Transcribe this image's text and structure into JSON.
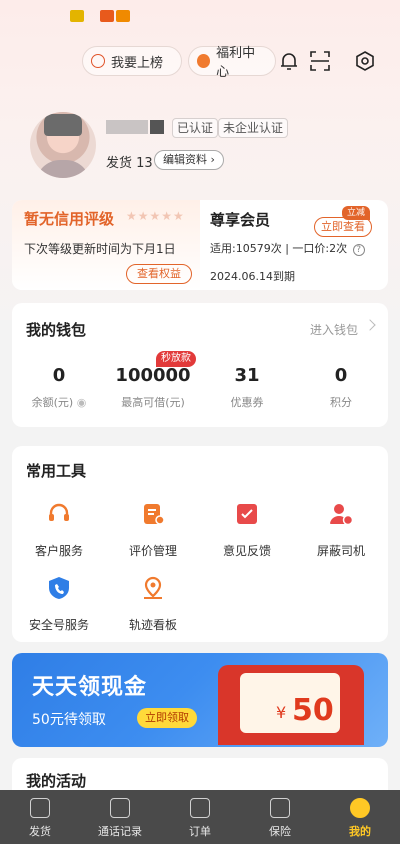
{
  "header": {
    "rank_label": "我要上榜",
    "welfare_label": "福利中心"
  },
  "profile": {
    "verified_tag": "已认证",
    "company_tag": "未企业认证",
    "shipments": "发货 13",
    "edit_label": "编辑资料"
  },
  "credit": {
    "title": "暂无信用评级",
    "stars": "★★★★★",
    "note": "下次等级更新时间为下月1日",
    "view_rights": "查看权益"
  },
  "member": {
    "title": "尊享会员",
    "renew_badge": "立减",
    "view_now": "立即查看",
    "usage": "适用:10579次 | 一口价:2次",
    "help": "?",
    "expire": "2024.06.14到期"
  },
  "wallet": {
    "title": "我的钱包",
    "link": "进入钱包",
    "flash_badge": "秒放款",
    "items": [
      {
        "value": "0",
        "label": "余额(元)"
      },
      {
        "value": "100000",
        "label": "最高可借(元)"
      },
      {
        "value": "31",
        "label": "优惠券"
      },
      {
        "value": "0",
        "label": "积分"
      }
    ]
  },
  "tools": {
    "title": "常用工具",
    "items": [
      {
        "label": "客户服务",
        "icon": "headset-icon",
        "color": "#f07a2e"
      },
      {
        "label": "评价管理",
        "icon": "review-icon",
        "color": "#f07a2e"
      },
      {
        "label": "意见反馈",
        "icon": "feedback-icon",
        "color": "#e84a4a"
      },
      {
        "label": "屏蔽司机",
        "icon": "block-driver-icon",
        "color": "#e84a4a"
      },
      {
        "label": "安全号服务",
        "icon": "safe-phone-icon",
        "color": "#2f7ee6"
      },
      {
        "label": "轨迹看板",
        "icon": "track-icon",
        "color": "#f07a2e"
      }
    ]
  },
  "banner": {
    "title": "天天领现金",
    "sub": "50元待领取",
    "button": "立即领取",
    "symbol": "¥",
    "amount": "50"
  },
  "activity": {
    "title": "我的活动"
  },
  "tabs": [
    {
      "label": "发货",
      "icon": "box-icon"
    },
    {
      "label": "通话记录",
      "icon": "phone-icon"
    },
    {
      "label": "订单",
      "icon": "order-icon"
    },
    {
      "label": "保险",
      "icon": "shield-icon"
    },
    {
      "label": "我的",
      "icon": "profile-icon",
      "active": true
    }
  ],
  "colors": {
    "accent": "#e2642a",
    "tab_active": "#ffc825",
    "banner_blue": "#2f7ee6"
  }
}
